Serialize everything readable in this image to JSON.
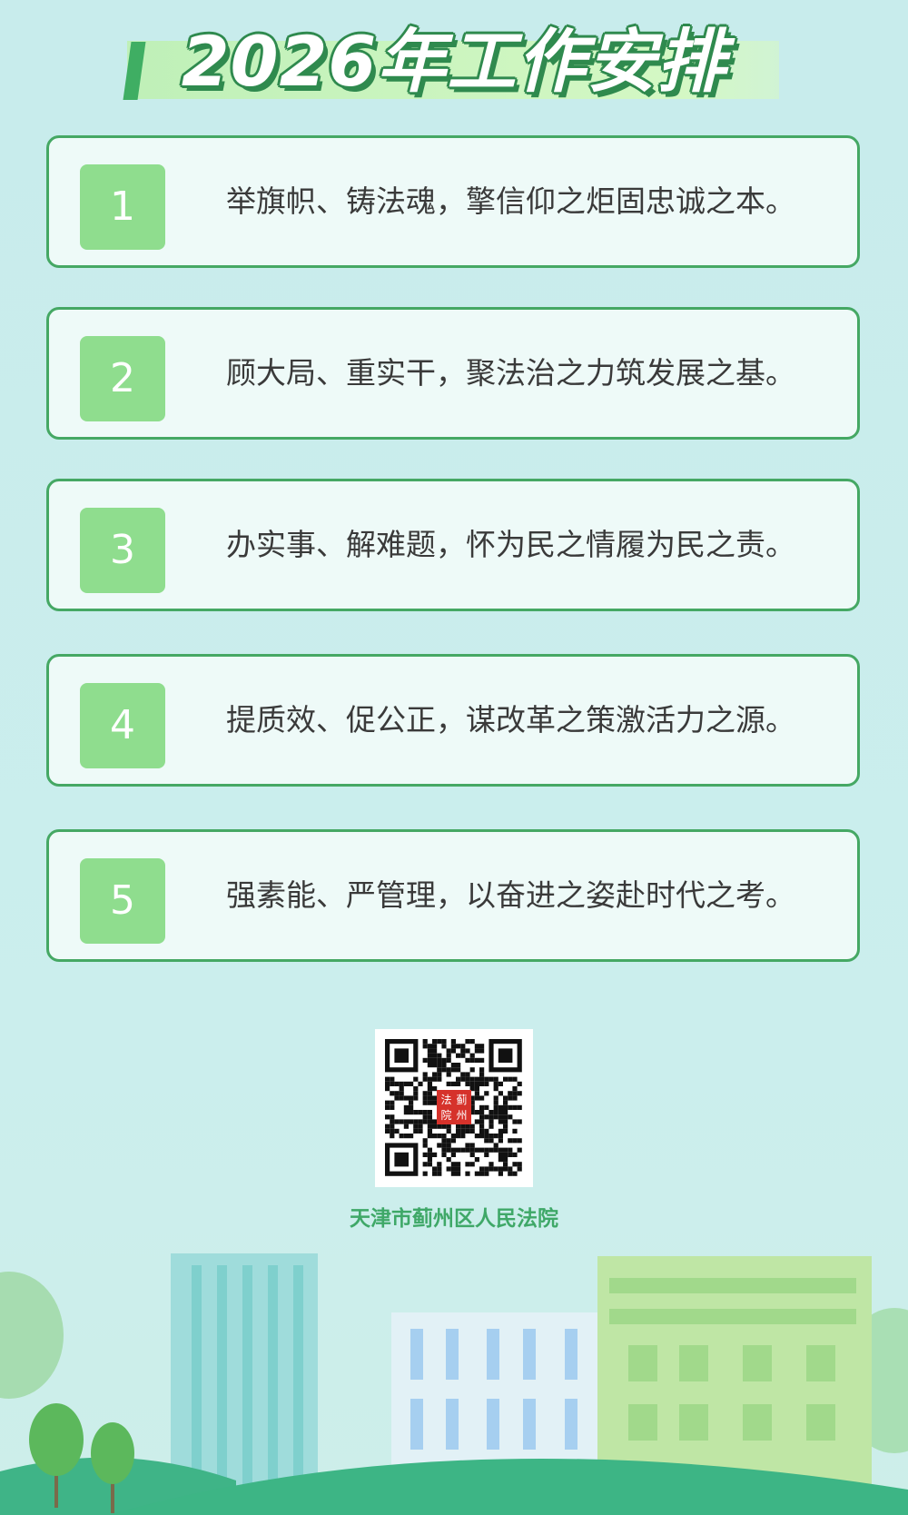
{
  "title": "2026年工作安排",
  "items": [
    {
      "number": "1",
      "text": "举旗帜、铸法魂，擎信仰之炬固忠诚之本。"
    },
    {
      "number": "2",
      "text": "顾大局、重实干，聚法治之力筑发展之基。"
    },
    {
      "number": "3",
      "text": "办实事、解难题，怀为民之情履为民之责。"
    },
    {
      "number": "4",
      "text": "提质效、促公正，谋改革之策激活力之源。"
    },
    {
      "number": "5",
      "text": "强素能、严管理，以奋进之姿赴时代之考。"
    }
  ],
  "qr_stamp": [
    "蓟",
    "州",
    "法",
    "院"
  ],
  "organization": "天津市蓟州区人民法院",
  "colors": {
    "background": "#cbeeed",
    "card_border": "#45a864",
    "badge": "#8fdd8e",
    "title_outline": "#2f8a4e",
    "org_text": "#3fa868"
  }
}
